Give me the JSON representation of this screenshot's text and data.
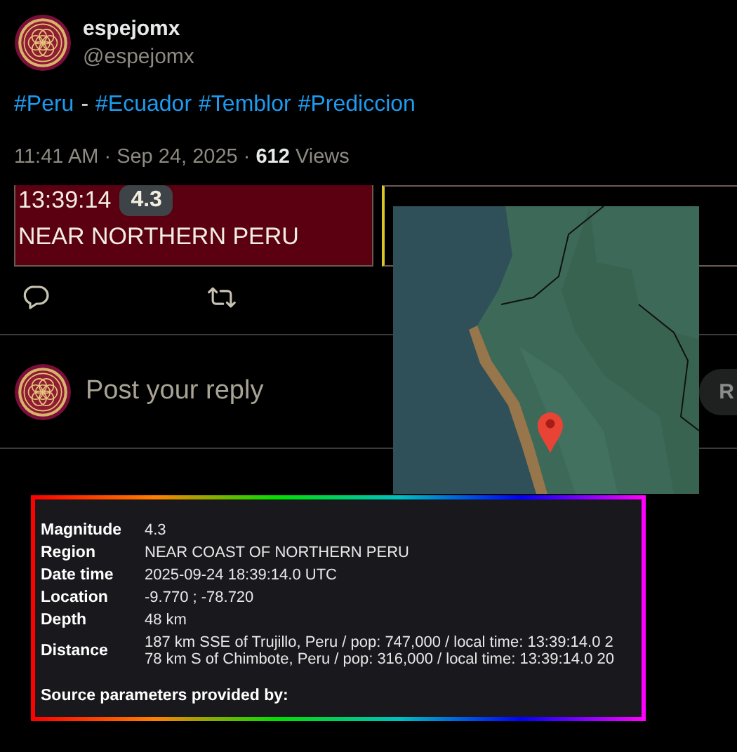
{
  "author": {
    "name": "espejomx",
    "handle": "@espejomx"
  },
  "text_parts": [
    {
      "kind": "hashtag",
      "text": "#Peru"
    },
    {
      "kind": "plain",
      "text": "-"
    },
    {
      "kind": "hashtag",
      "text": "#Ecuador"
    },
    {
      "kind": "hashtag",
      "text": "#Temblor"
    },
    {
      "kind": "hashtag",
      "text": "#Prediccion"
    }
  ],
  "meta": "11:41 AM · Sep 24, 2025 · **612** Views",
  "banner": {
    "time": "13:39:14",
    "magnitude": "4.3",
    "region": "NEAR NORTHERN PERU"
  },
  "actions": [
    {
      "kind": "comment"
    },
    {
      "kind": "repost"
    }
  ],
  "reply": {
    "placeholder": "Post your reply",
    "button": "R"
  },
  "details": {
    "rows": [
      {
        "label": "Magnitude",
        "lines": [
          "4.3"
        ]
      },
      {
        "label": "Region",
        "lines": [
          "NEAR COAST OF NORTHERN PERU"
        ]
      },
      {
        "label": "Date time",
        "lines": [
          "2025-09-24 18:39:14.0 UTC"
        ]
      },
      {
        "label": "Location",
        "lines": [
          "-9.770 ; -78.720"
        ]
      },
      {
        "label": "Depth",
        "lines": [
          "48 km"
        ]
      },
      {
        "label": "Distance",
        "lines": [
          "187 km SSE of Trujillo, Peru / pop: 747,000 / local time: 13:39:14.0 2",
          "78 km S of Chimbote, Peru / pop: 316,000 / local time: 13:39:14.0 20"
        ]
      }
    ],
    "footer": "Source parameters provided by:"
  }
}
